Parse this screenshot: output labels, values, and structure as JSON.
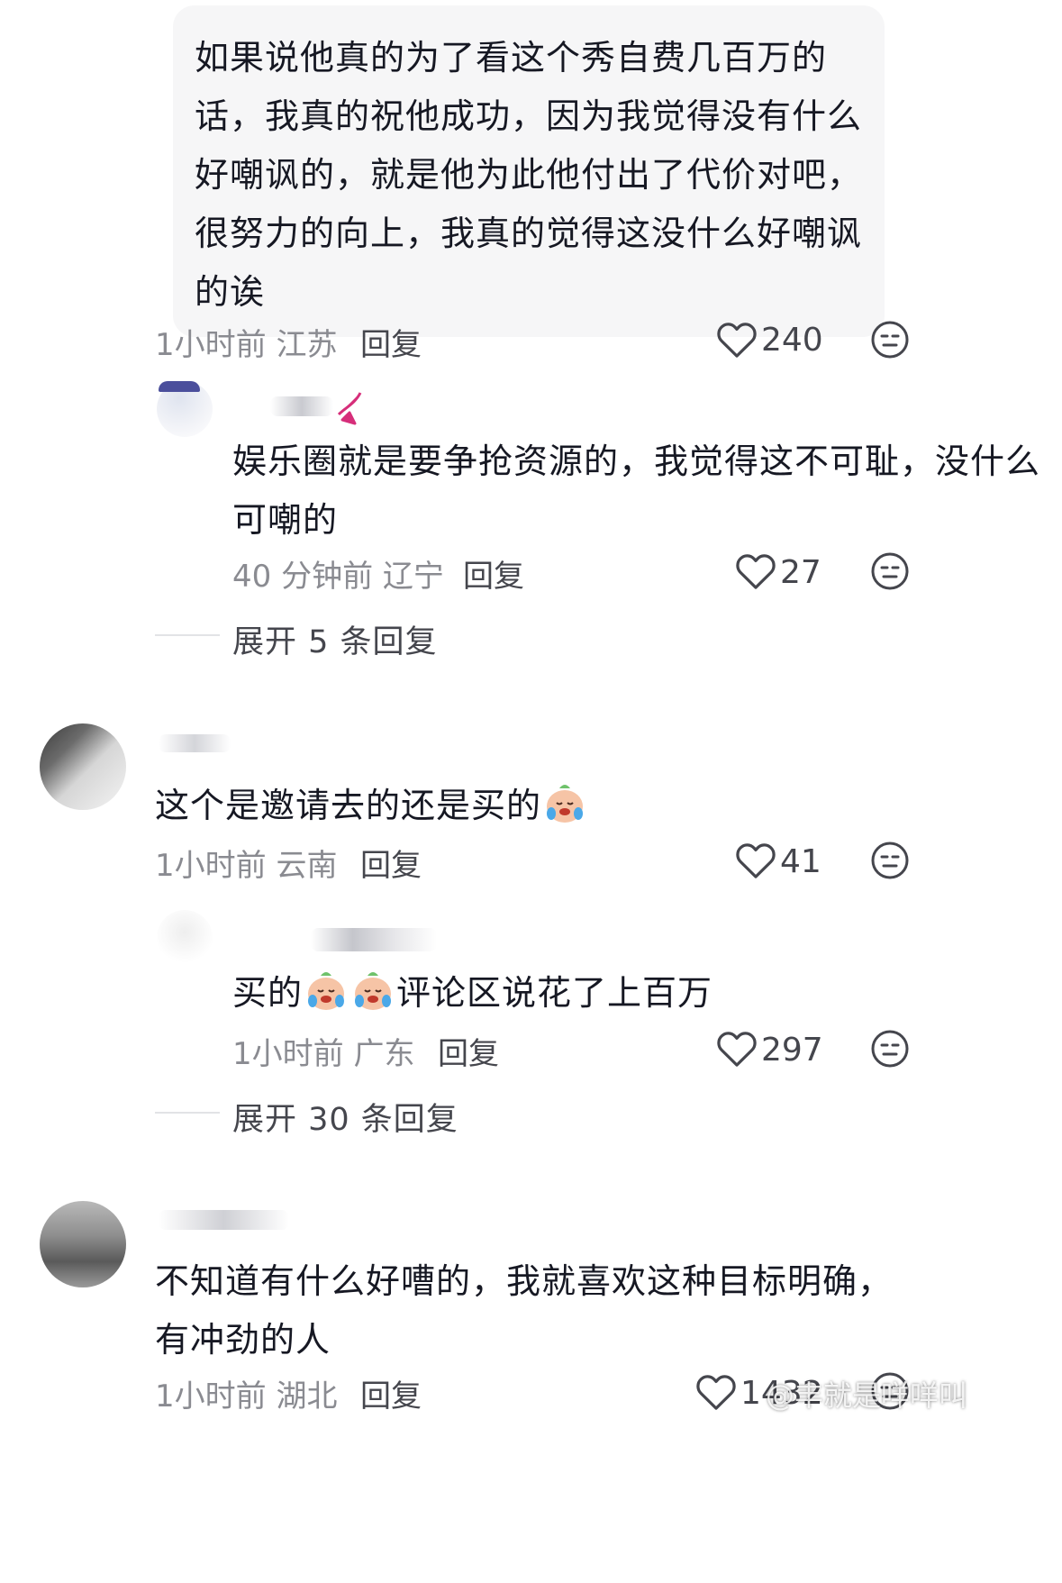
{
  "comments": [
    {
      "text": "如果说他真的为了看这个秀自费几百万的话，我真的祝他成功，因为我觉得没有什么好嘲讽的，就是他为此他付出了代价对吧，很努力的向上，我真的觉得这没什么好嘲讽的诶",
      "meta": "1小时前 江苏",
      "reply": "回复",
      "likes": "240"
    },
    {
      "text": "娱乐圈就是要争抢资源的，我觉得这不可耻，没什么可嘲的",
      "meta": "40 分钟前 辽宁",
      "reply": "回复",
      "likes": "27",
      "expand": "展开 5 条回复"
    },
    {
      "text": "这个是邀请去的还是买的",
      "meta": "1小时前 云南",
      "reply": "回复",
      "likes": "41"
    },
    {
      "text_a": "买的",
      "text_b": "评论区说花了上百万",
      "meta": "1小时前 广东",
      "reply": "回复",
      "likes": "297",
      "expand": "展开 30 条回复"
    },
    {
      "text": "不知道有什么好嘈的，我就喜欢这种目标明确，有冲劲的人",
      "meta": "1小时前 湖北",
      "reply": "回复",
      "likes": "1432"
    }
  ],
  "icons": {
    "like": "heart-outline-icon",
    "reaction": "neutral-face-icon",
    "emoji": "crying-face-emoji"
  },
  "watermark": "@丰就是咩咩叫",
  "colors": {
    "text": "#161823",
    "meta": "#8a8b91",
    "bubble": "#f6f6f7"
  }
}
